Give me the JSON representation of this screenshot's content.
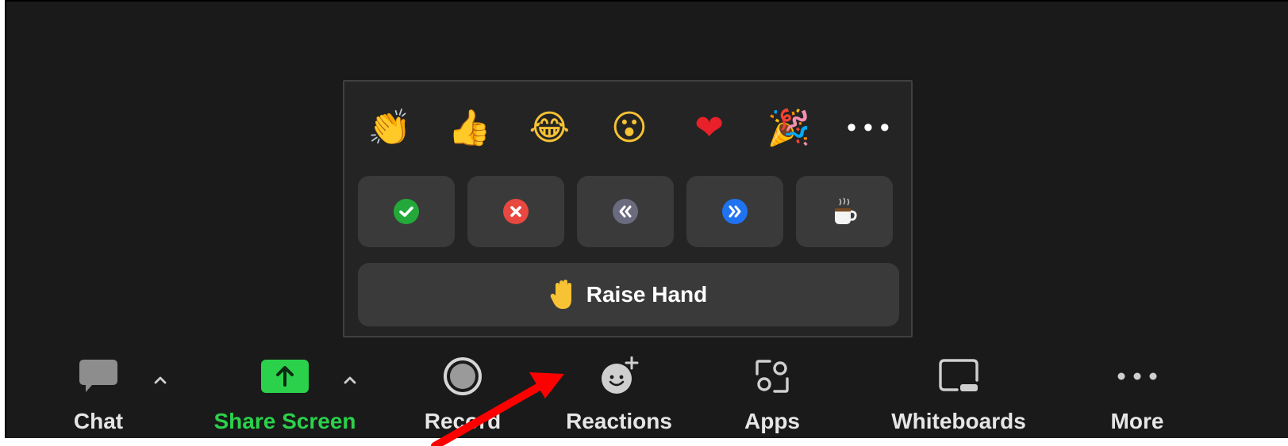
{
  "reactions_popup": {
    "emojis": [
      {
        "icon": "clapping-hands-icon",
        "glyph": "👏"
      },
      {
        "icon": "thumbs-up-icon",
        "glyph": "👍"
      },
      {
        "icon": "tears-of-joy-icon",
        "glyph": "😂"
      },
      {
        "icon": "open-mouth-icon",
        "glyph": "😮"
      },
      {
        "icon": "red-heart-icon",
        "glyph": "❤"
      },
      {
        "icon": "party-popper-icon",
        "glyph": "🎉"
      }
    ],
    "more_glyph": "•••",
    "status_buttons": [
      {
        "icon": "yes-check-icon",
        "color": "#22a93a"
      },
      {
        "icon": "no-x-icon",
        "color": "#e8483f"
      },
      {
        "icon": "slow-down-icon",
        "color": "#6b6b80"
      },
      {
        "icon": "speed-up-icon",
        "color": "#1f73f0"
      },
      {
        "icon": "coffee-break-icon",
        "color": "#ffffff"
      }
    ],
    "raise_hand": {
      "icon": "raised-hand-icon",
      "label": "Raise Hand"
    }
  },
  "toolbar": {
    "items": [
      {
        "label": "Chat",
        "icon": "chat-icon"
      },
      {
        "label": "Share Screen",
        "icon": "share-screen-icon",
        "color": "#2bd14b"
      },
      {
        "label": "Record",
        "icon": "record-icon"
      },
      {
        "label": "Reactions",
        "icon": "reactions-icon"
      },
      {
        "label": "Apps",
        "icon": "apps-icon"
      },
      {
        "label": "Whiteboards",
        "icon": "whiteboard-icon"
      },
      {
        "label": "More",
        "icon": "more-dots-icon"
      }
    ]
  },
  "colors": {
    "background": "#1a1a1a",
    "popup": "#242424",
    "button": "#3a3a3a",
    "annotation_arrow": "#ff0000"
  }
}
